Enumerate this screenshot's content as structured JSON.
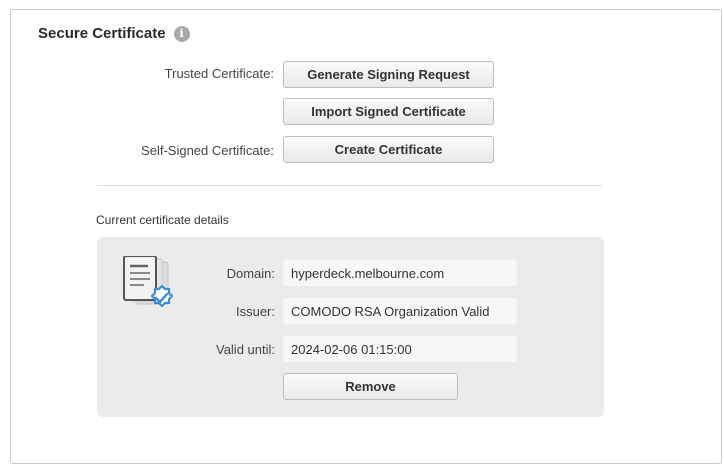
{
  "section": {
    "title": "Secure Certificate",
    "info_icon": "i"
  },
  "trusted": {
    "label": "Trusted Certificate:",
    "generate_button": "Generate Signing Request",
    "import_button": "Import Signed Certificate"
  },
  "self_signed": {
    "label": "Self-Signed Certificate:",
    "create_button": "Create Certificate"
  },
  "current": {
    "heading": "Current certificate details",
    "domain_label": "Domain:",
    "domain_value": "hyperdeck.melbourne.com",
    "issuer_label": "Issuer:",
    "issuer_value": "COMODO RSA Organization Valid",
    "valid_label": "Valid until:",
    "valid_value": "2024-02-06 01:15:00",
    "remove_button": "Remove",
    "icon": "certificate-check-icon"
  },
  "colors": {
    "accent": "#3a8be0",
    "box_bg": "#ebebeb"
  }
}
